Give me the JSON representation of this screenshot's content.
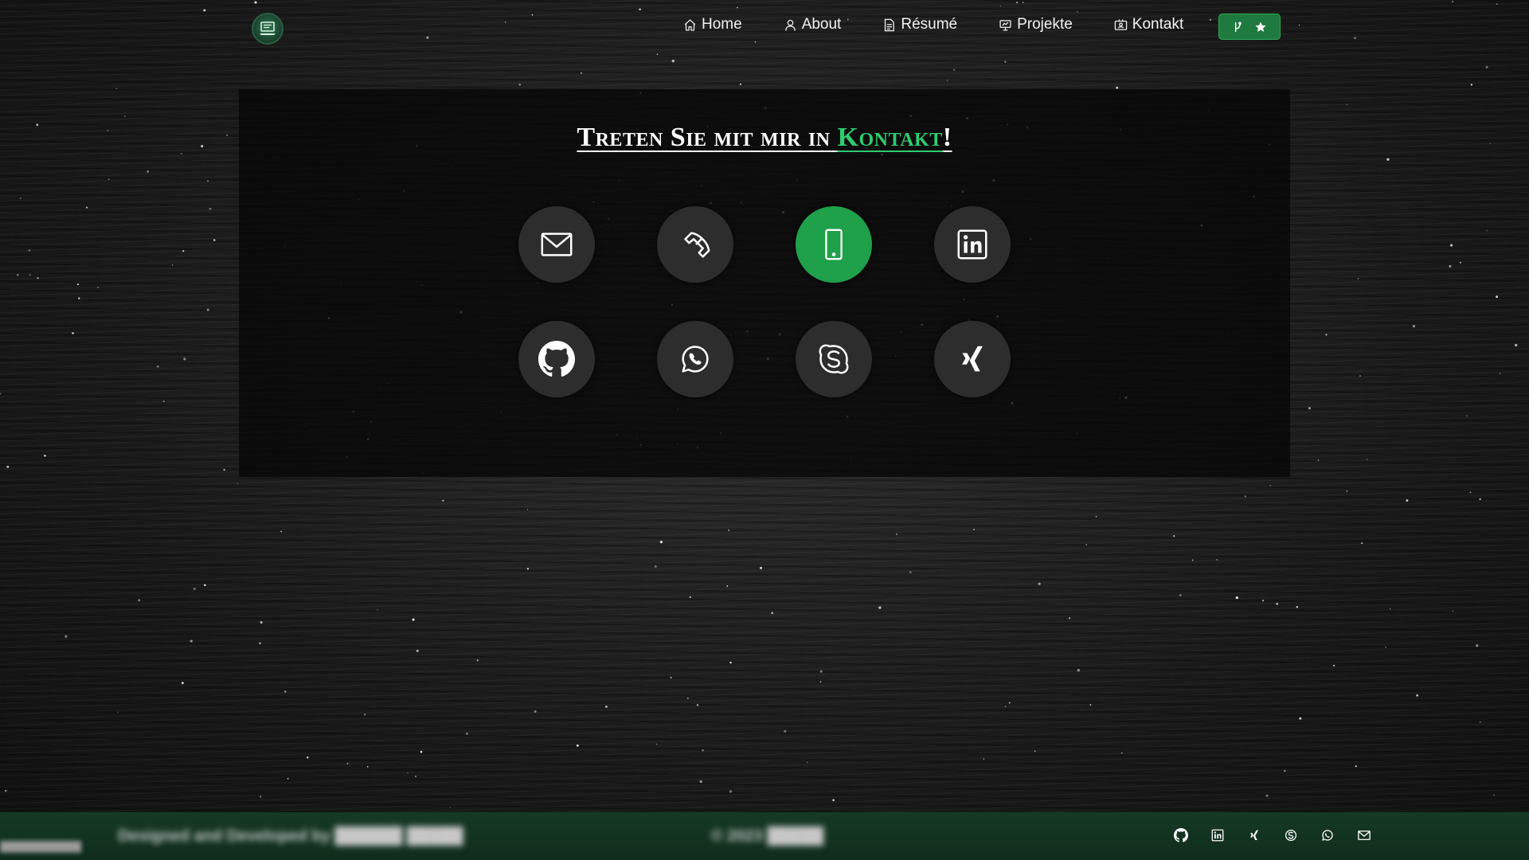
{
  "nav": {
    "items": [
      {
        "label": "Home",
        "icon": "home-icon"
      },
      {
        "label": "About",
        "icon": "user-icon"
      },
      {
        "label": "Résumé",
        "icon": "document-icon"
      },
      {
        "label": "Projekte",
        "icon": "presentation-icon"
      },
      {
        "label": "Kontakt",
        "icon": "contact-card-icon"
      }
    ],
    "button": {
      "icons": [
        "git-icon",
        "star-icon"
      ],
      "color": "#1e7a3e"
    }
  },
  "contact": {
    "heading_part1": "Treten Sie mit mir in ",
    "heading_part2": "Kontakt",
    "heading_part3": "!",
    "accent_color": "#2ecc71",
    "icons": [
      {
        "name": "email-icon",
        "active": false
      },
      {
        "name": "phone-icon",
        "active": false
      },
      {
        "name": "mobile-icon",
        "active": true
      },
      {
        "name": "linkedin-icon",
        "active": false
      },
      {
        "name": "github-icon",
        "active": false
      },
      {
        "name": "whatsapp-icon",
        "active": false
      },
      {
        "name": "skype-icon",
        "active": false
      },
      {
        "name": "xing-icon",
        "active": false
      }
    ]
  },
  "footer": {
    "left_text": "Designed and Developed by ██████ █████",
    "center_text": "© 2023 █████",
    "corner_text": "████████████",
    "icons": [
      "github-icon",
      "linkedin-icon",
      "xing-icon",
      "skype-icon",
      "whatsapp-icon",
      "email-icon"
    ],
    "color": "#153a24"
  }
}
